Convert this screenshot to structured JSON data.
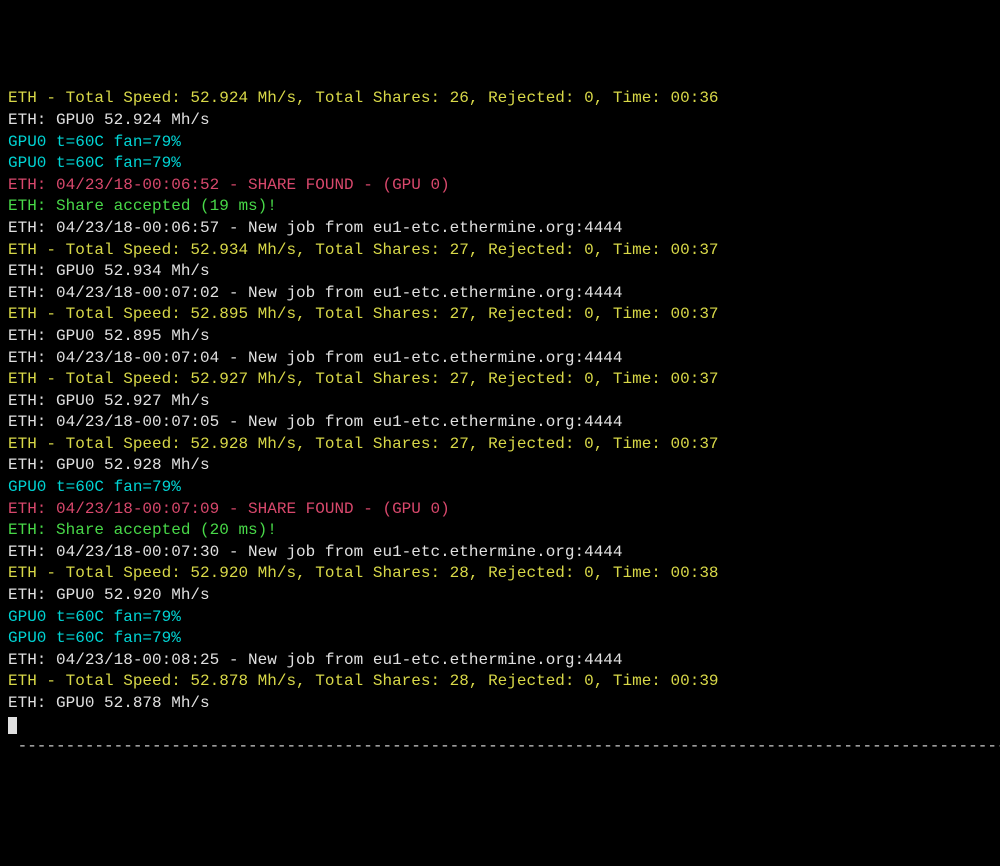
{
  "lines": [
    {
      "color": "yellow",
      "text": "ETH - Total Speed: 52.924 Mh/s, Total Shares: 26, Rejected: 0, Time: 00:36"
    },
    {
      "color": "white",
      "text": "ETH: GPU0 52.924 Mh/s"
    },
    {
      "color": "cyan",
      "text": "GPU0 t=60C fan=79%"
    },
    {
      "color": "cyan",
      "text": "GPU0 t=60C fan=79%"
    },
    {
      "color": "red",
      "text": "ETH: 04/23/18-00:06:52 - SHARE FOUND - (GPU 0)"
    },
    {
      "color": "green",
      "text": "ETH: Share accepted (19 ms)!"
    },
    {
      "color": "white",
      "text": "ETH: 04/23/18-00:06:57 - New job from eu1-etc.ethermine.org:4444"
    },
    {
      "color": "yellow",
      "text": "ETH - Total Speed: 52.934 Mh/s, Total Shares: 27, Rejected: 0, Time: 00:37"
    },
    {
      "color": "white",
      "text": "ETH: GPU0 52.934 Mh/s"
    },
    {
      "color": "white",
      "text": "ETH: 04/23/18-00:07:02 - New job from eu1-etc.ethermine.org:4444"
    },
    {
      "color": "yellow",
      "text": "ETH - Total Speed: 52.895 Mh/s, Total Shares: 27, Rejected: 0, Time: 00:37"
    },
    {
      "color": "white",
      "text": "ETH: GPU0 52.895 Mh/s"
    },
    {
      "color": "white",
      "text": "ETH: 04/23/18-00:07:04 - New job from eu1-etc.ethermine.org:4444"
    },
    {
      "color": "yellow",
      "text": "ETH - Total Speed: 52.927 Mh/s, Total Shares: 27, Rejected: 0, Time: 00:37"
    },
    {
      "color": "white",
      "text": "ETH: GPU0 52.927 Mh/s"
    },
    {
      "color": "white",
      "text": "ETH: 04/23/18-00:07:05 - New job from eu1-etc.ethermine.org:4444"
    },
    {
      "color": "yellow",
      "text": "ETH - Total Speed: 52.928 Mh/s, Total Shares: 27, Rejected: 0, Time: 00:37"
    },
    {
      "color": "white",
      "text": "ETH: GPU0 52.928 Mh/s"
    },
    {
      "color": "cyan",
      "text": "GPU0 t=60C fan=79%"
    },
    {
      "color": "red",
      "text": "ETH: 04/23/18-00:07:09 - SHARE FOUND - (GPU 0)"
    },
    {
      "color": "green",
      "text": "ETH: Share accepted (20 ms)!"
    },
    {
      "color": "white",
      "text": "ETH: 04/23/18-00:07:30 - New job from eu1-etc.ethermine.org:4444"
    },
    {
      "color": "yellow",
      "text": "ETH - Total Speed: 52.920 Mh/s, Total Shares: 28, Rejected: 0, Time: 00:38"
    },
    {
      "color": "white",
      "text": "ETH: GPU0 52.920 Mh/s"
    },
    {
      "color": "cyan",
      "text": "GPU0 t=60C fan=79%"
    },
    {
      "color": "cyan",
      "text": "GPU0 t=60C fan=79%"
    },
    {
      "color": "white",
      "text": "ETH: 04/23/18-00:08:25 - New job from eu1-etc.ethermine.org:4444"
    },
    {
      "color": "yellow",
      "text": "ETH - Total Speed: 52.878 Mh/s, Total Shares: 28, Rejected: 0, Time: 00:39"
    },
    {
      "color": "white",
      "text": "ETH: GPU0 52.878 Mh/s"
    }
  ],
  "separator": " ------------------------------------------------------------------------------------------------------------"
}
